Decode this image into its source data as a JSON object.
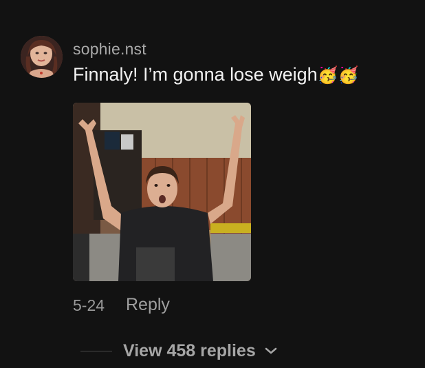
{
  "comment": {
    "username": "sophie.nst",
    "text": "Finnaly! I’m gonna lose weigh",
    "emojis": "🥳🥳",
    "date": "5-24",
    "reply_label": "Reply"
  },
  "replies": {
    "label": "View 458 replies",
    "icon": "chevron-down-icon"
  },
  "colors": {
    "background": "#121212",
    "username": "#a9a9a9",
    "text": "#f2f2f2",
    "muted": "#9a9a9a"
  }
}
